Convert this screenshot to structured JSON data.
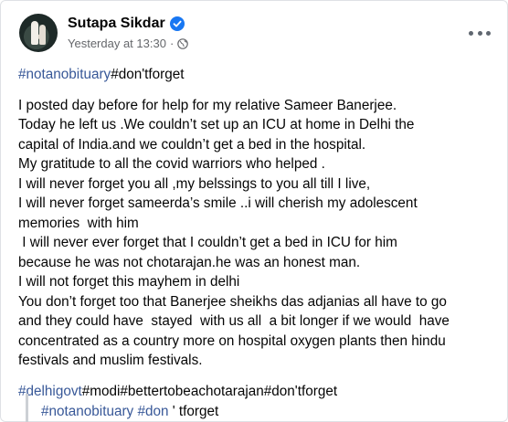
{
  "post": {
    "author": "Sutapa Sikdar",
    "timestamp": "Yesterday at 13:30",
    "separator": "·",
    "hashtags_top": [
      "#notanobituary",
      "#don'tforget"
    ],
    "body_lines": [
      "I posted day before for help for my relative Sameer Banerjee.",
      "Today he left us .We couldn’t set up an ICU at home in Delhi the",
      "capital of India.and we couldn’t get a bed in the hospital.",
      "My gratitude to all the covid warriors who helped .",
      "I will never forget you all ,my belssings to you all till I live,",
      "I will never forget sameerda’s smile ..i will cherish my adolescent",
      "memories  with him",
      " I will never ever forget that I couldn’t get a bed in ICU for him",
      "because he was not chotarajan.he was an honest man.",
      "I will not forget this mayhem in delhi",
      "You don’t forget too that Banerjee sheikhs das adjanias all have to go",
      "and they could have  stayed  with us all  a bit longer if we would  have",
      "concentrated as a country more on hospital oxygen plants then hindu",
      "festivals and muslim festivals."
    ],
    "hashtags_bottom": [
      "#delhigovt",
      "#modi",
      "#bettertobeachotarajan",
      "#don'tforget"
    ],
    "quote": {
      "tag1": "#notanobituary",
      "tag2": "#don",
      "rest": " ' tforget"
    }
  },
  "icons": {
    "verified": "verified-badge-icon",
    "privacy": "globe-icon",
    "more": "more-options-icon"
  },
  "colors": {
    "hashtag": "#385898",
    "verified": "#1877f2",
    "text": "#050505",
    "meta": "#65676b"
  }
}
